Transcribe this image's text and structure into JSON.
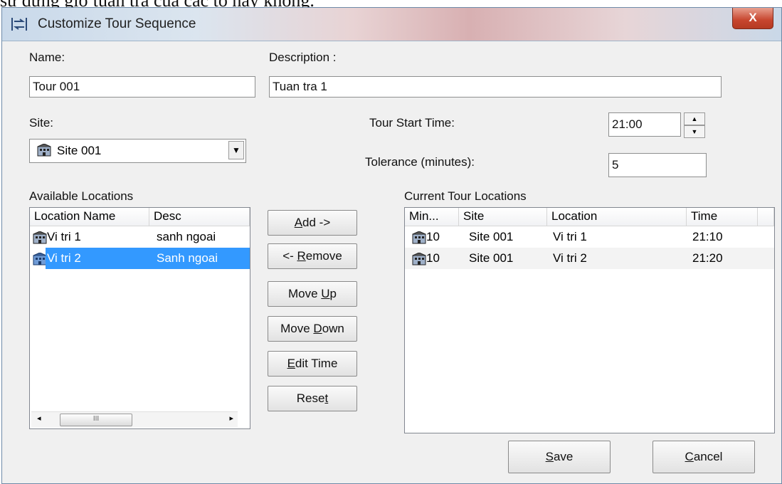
{
  "background_text": "sự dừng giờ tuần tra của các tổ hay không.",
  "window": {
    "title": "Customize Tour Sequence",
    "close_label": "X"
  },
  "form": {
    "name_label": "Name:",
    "name_value": "Tour 001",
    "description_label": "Description :",
    "description_value": "Tuan tra 1",
    "site_label": "Site:",
    "site_value": "Site 001",
    "tour_start_label": "Tour Start Time:",
    "tour_start_value": "21:00",
    "tolerance_label": "Tolerance (minutes):",
    "tolerance_value": "5"
  },
  "available": {
    "label": "Available Locations",
    "columns": [
      "Location Name",
      "Desc"
    ],
    "rows": [
      {
        "name": "Vi tri 1",
        "desc": "sanh ngoai",
        "selected": false
      },
      {
        "name": "Vi tri 2",
        "desc": "Sanh ngoai",
        "selected": true
      }
    ],
    "scroll_thumb": "III"
  },
  "buttons": {
    "add": "Add ->",
    "remove": "<- Remove",
    "move_up": "Move Up",
    "move_down": "Move Down",
    "edit_time": "Edit Time",
    "reset": "Reset",
    "save": "Save",
    "cancel": "Cancel"
  },
  "current": {
    "label": "Current Tour Locations",
    "columns": [
      "Min...",
      "Site",
      "Location",
      "Time"
    ],
    "rows": [
      {
        "min": "10",
        "site": "Site 001",
        "location": "Vi tri 1",
        "time": "21:10"
      },
      {
        "min": "10",
        "site": "Site 001",
        "location": "Vi tri 2",
        "time": "21:20"
      }
    ]
  },
  "colors": {
    "selection": "#3399ff",
    "close_button": "#c7452e"
  },
  "icons": {
    "title": "tour-sequence-icon",
    "site": "building-icon",
    "location": "building-icon"
  }
}
